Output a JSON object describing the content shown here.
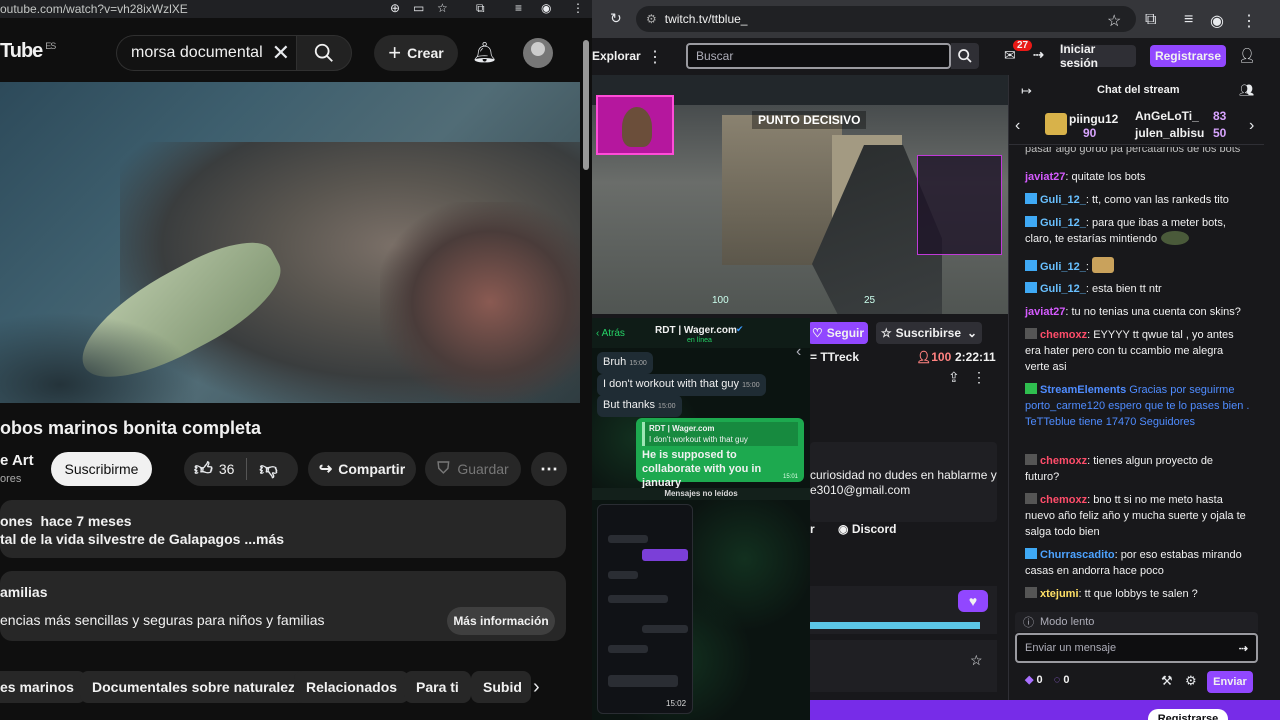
{
  "yt": {
    "url": "outube.com/watch?v=vh28ixWzlXE",
    "logo": "Tube",
    "logo_suffix": "ES",
    "search_value": "morsa documental",
    "create_label": "Crear",
    "title": "obos marinos bonita completa",
    "channel": "e Art",
    "channel_sub": "ores",
    "subscribe": "Suscribirme",
    "likes": "36",
    "share": "Compartir",
    "save": "Guardar",
    "desc_meta": "ones  hace 7 meses",
    "desc_text": "tal de la vida silvestre de Galapagos ...más",
    "info_title": "amilias",
    "info_text": "encias más sencillas y seguras para niños y familias",
    "info_more": "Más información",
    "chips": [
      "es marinos",
      "Documentales sobre naturaleza",
      "Relacionados",
      "Para ti",
      "Subid"
    ]
  },
  "tw": {
    "url": "twitch.tv/ttblue_",
    "explore": "Explorar",
    "search_placeholder": "Buscar",
    "notif_count": "27",
    "login": "Iniciar sesión",
    "signup": "Registrarse",
    "chat_title": "Chat del stream",
    "gift1_user": "piingu12",
    "gift1_count": "90",
    "gift2_user": "AnGeLoTi_",
    "gift2_count": "83",
    "gift3_user": "julen_albisu",
    "gift3_count": "50",
    "follow": "Seguir",
    "subscribe": "Suscribirse",
    "streamer_partial": "= TTreck",
    "viewers": "100",
    "uptime": "2:22:11",
    "about1": "curiosidad no dudes en hablarme y",
    "about2": "e3010@gmail.com",
    "discord": "Discord",
    "partial_r": "r",
    "slow_mode": "Modo lento",
    "chat_placeholder": "Enviar un mensaje",
    "points1": "0",
    "points2": "0",
    "send": "Enviar",
    "bottom_btn": "Registrarse",
    "game_overlay": "PUNTO DECISIVO",
    "hud1": "100",
    "hud2": "25"
  },
  "wa": {
    "back": "Atrás",
    "contact": "RDT | Wager.com",
    "status": "en línea",
    "m1": "Bruh",
    "t1": "15:00",
    "m2": "I don't workout with that guy",
    "t2": "15:00",
    "m3": "But thanks",
    "t3": "15:00",
    "reply_from": "RDT | Wager.com",
    "reply_quote": "I don't workout with that guy",
    "reply_text": "He is supposed to collaborate with you in january",
    "t4": "15:01",
    "unread": "Mensajes no leídos",
    "phone_time": "15:02"
  },
  "chat": [
    {
      "user": "",
      "text": "pasar algo gordo pa percatarnos de los bots",
      "color": "#bfbfbf"
    },
    {
      "user": "javiat27",
      "text": ": quitate los bots",
      "color": "#d55bff"
    },
    {
      "user": "Guli_12_",
      "text": ": tt, como van las rankeds tito",
      "color": "#69c0ff",
      "badge": true
    },
    {
      "user": "Guli_12_",
      "text": ": para que ibas a meter bots, claro, te estarías mintiendo",
      "color": "#69c0ff",
      "badge": true
    },
    {
      "user": "Guli_12_",
      "text": ":",
      "color": "#69c0ff",
      "badge": true
    },
    {
      "user": "Guli_12_",
      "text": ": esta bien tt ntr",
      "color": "#69c0ff",
      "badge": true
    },
    {
      "user": "javiat27",
      "text": ": tu no tenias una cuenta con skins?",
      "color": "#d55bff"
    },
    {
      "user": "chemoxz",
      "text": ": EYYYY tt qwue tal , yo antes era hater pero con tu ccambio me alegra verte asi",
      "color": "#ff4d6a"
    },
    {
      "user": "StreamElements",
      "text": "Gracias por seguirme porto_carme120 espero que te lo pases bien . TeTTeblue tiene 17470 Seguidores",
      "color": "#4f8cff"
    },
    {
      "user": "chemoxz",
      "text": ": tienes algun proyecto de futuro?",
      "color": "#ff4d6a"
    },
    {
      "user": "chemoxz",
      "text": ": bno tt si no me meto hasta nuevo año feliz año y mucha suerte y ojala te salga todo bien",
      "color": "#ff4d6a"
    },
    {
      "user": "Churrascadito",
      "text": ": por eso estabas mirando casas en andorra hace poco",
      "color": "#4da3ff"
    },
    {
      "user": "xtejumi",
      "text": ": tt que lobbys te salen ?",
      "color": "#ffe066"
    }
  ]
}
